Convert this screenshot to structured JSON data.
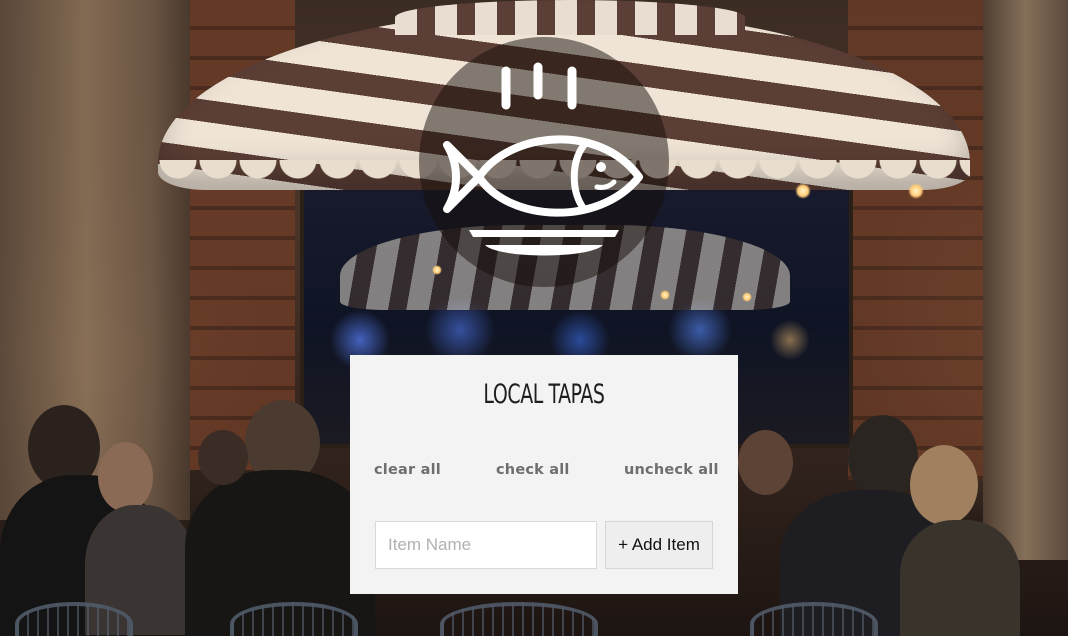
{
  "app": {
    "title": "LOCAL TAPAS",
    "logo_icon": "fish-on-plate-icon"
  },
  "actions": {
    "clear_all": "clear all",
    "check_all": "check all",
    "uncheck_all": "uncheck all"
  },
  "add_item": {
    "input_value": "",
    "input_placeholder": "Item Name",
    "button_label": "+ Add Item"
  },
  "colors": {
    "panel_bg": "#f3f3f4",
    "title_text": "#1e1e1e",
    "action_text": "#6e6e6e",
    "button_bg": "#eeeeee",
    "logo_overlay": "rgba(22,14,10,0.5)"
  }
}
